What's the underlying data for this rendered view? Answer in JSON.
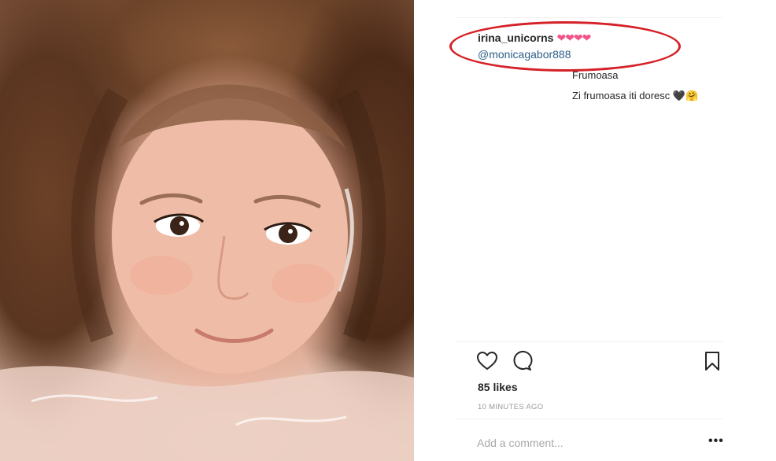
{
  "post": {
    "username": "irina_unicorns",
    "hearts": "❤❤❤❤",
    "mention": "@monicagabor888",
    "comments": [
      "Frumoasa",
      "Zi frumoasa iti doresc 🖤🤗"
    ],
    "likes": "85 likes",
    "time_ago": "10 MINUTES AGO",
    "comment_placeholder": "Add a comment...",
    "more_label": "•••"
  },
  "icons": {
    "like": "heart-icon",
    "comment": "comment-bubble-icon",
    "save": "bookmark-icon"
  },
  "colors": {
    "hearts": "#f0548a",
    "mention": "#2e5f8a",
    "annotation": "#d52128"
  }
}
